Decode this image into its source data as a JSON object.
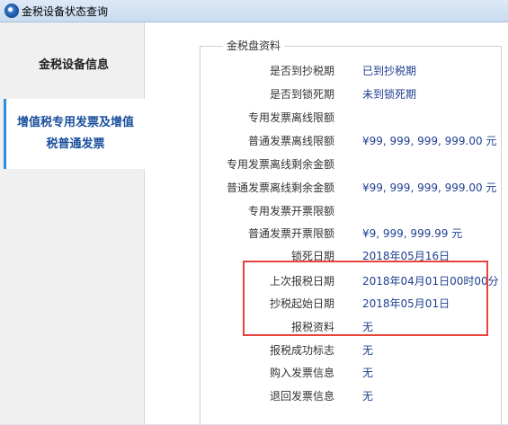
{
  "window": {
    "title": "金税设备状态查询"
  },
  "nav": {
    "items": [
      {
        "label": "金税设备信息"
      },
      {
        "label": "增值税专用发票及增值税普通发票"
      }
    ]
  },
  "section": {
    "legend": "金税盘资料",
    "rows": [
      {
        "label": "是否到抄税期",
        "value": "已到抄税期"
      },
      {
        "label": "是否到锁死期",
        "value": "未到锁死期"
      },
      {
        "label": "专用发票离线限额",
        "value": ""
      },
      {
        "label": "普通发票离线限额",
        "value": "¥99, 999, 999, 999.00 元"
      },
      {
        "label": "专用发票离线剩余金额",
        "value": ""
      },
      {
        "label": "普通发票离线剩余金额",
        "value": "¥99, 999, 999, 999.00 元"
      },
      {
        "label": "专用发票开票限额",
        "value": ""
      },
      {
        "label": "普通发票开票限额",
        "value": "¥9, 999, 999.99 元"
      },
      {
        "label": "锁死日期",
        "value": "2018年05月16日"
      },
      {
        "label": "上次报税日期",
        "value": "2018年04月01日00时00分"
      },
      {
        "label": "抄税起始日期",
        "value": "2018年05月01日"
      },
      {
        "label": "报税资料",
        "value": "无"
      },
      {
        "label": "报税成功标志",
        "value": "无"
      },
      {
        "label": "购入发票信息",
        "value": "无"
      },
      {
        "label": "退回发票信息",
        "value": "无"
      }
    ]
  },
  "annotation": {
    "color": "#e8423c"
  }
}
